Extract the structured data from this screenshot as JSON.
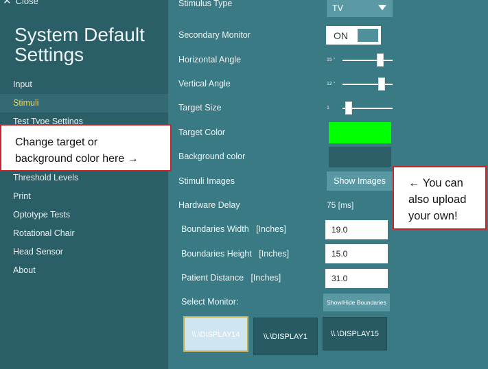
{
  "sidebar": {
    "close_label": "Close",
    "title_line1": "System Default",
    "title_line2": "Settings",
    "items": [
      {
        "label": "Input"
      },
      {
        "label": "Stimuli"
      },
      {
        "label": "Test Type Settings"
      },
      {
        "label": "Threshold Levels"
      },
      {
        "label": "Print"
      },
      {
        "label": "Optotype Tests"
      },
      {
        "label": "Rotational Chair"
      },
      {
        "label": "Head Sensor"
      },
      {
        "label": "About"
      }
    ],
    "selected": "Stimuli"
  },
  "settings": {
    "stimulus_type": {
      "label": "Stimulus Type",
      "value": "TV"
    },
    "secondary_monitor": {
      "label": "Secondary Monitor",
      "value": "ON"
    },
    "horizontal_angle": {
      "label": "Horizontal Angle",
      "value_text": "15 °",
      "fraction": 0.76
    },
    "vertical_angle": {
      "label": "Vertical Angle",
      "value_text": "12 °",
      "fraction": 0.81
    },
    "target_size": {
      "label": "Target Size",
      "value_text": "1",
      "fraction": 0.12
    },
    "target_color": {
      "label": "Target Color",
      "color": "#00ff00"
    },
    "background_color": {
      "label": "Background color",
      "color": "#2b5e66"
    },
    "stimuli_images": {
      "label": "Stimuli Images",
      "button": "Show Images"
    },
    "hardware_delay": {
      "label": "Hardware Delay",
      "value": "75 [ms]"
    },
    "boundaries_width": {
      "label": "Boundaries Width   [Inches]",
      "value": "19.0"
    },
    "boundaries_height": {
      "label": "Boundaries Height   [Inches]",
      "value": "15.0"
    },
    "patient_distance": {
      "label": "Patient Distance   [Inches]",
      "value": "31.0"
    },
    "select_monitor": {
      "label": "Select Monitor:",
      "boundaries_button": "Show/Hide Boundaries"
    },
    "monitors": [
      "\\\\.\\DISPLAY14",
      "\\\\.\\DISPLAY1",
      "\\\\.\\DISPLAY15"
    ]
  },
  "callouts": {
    "left_line1": "Change target or",
    "left_line2": "background color here →",
    "right_line1": "← You can",
    "right_line2": "also upload",
    "right_line3": "your own!"
  },
  "colors": {
    "sidebar_bg": "#2a5f68",
    "main_bg": "#3a7a84",
    "accent_selected": "#f2d24e",
    "callout_border": "#c3262b"
  }
}
